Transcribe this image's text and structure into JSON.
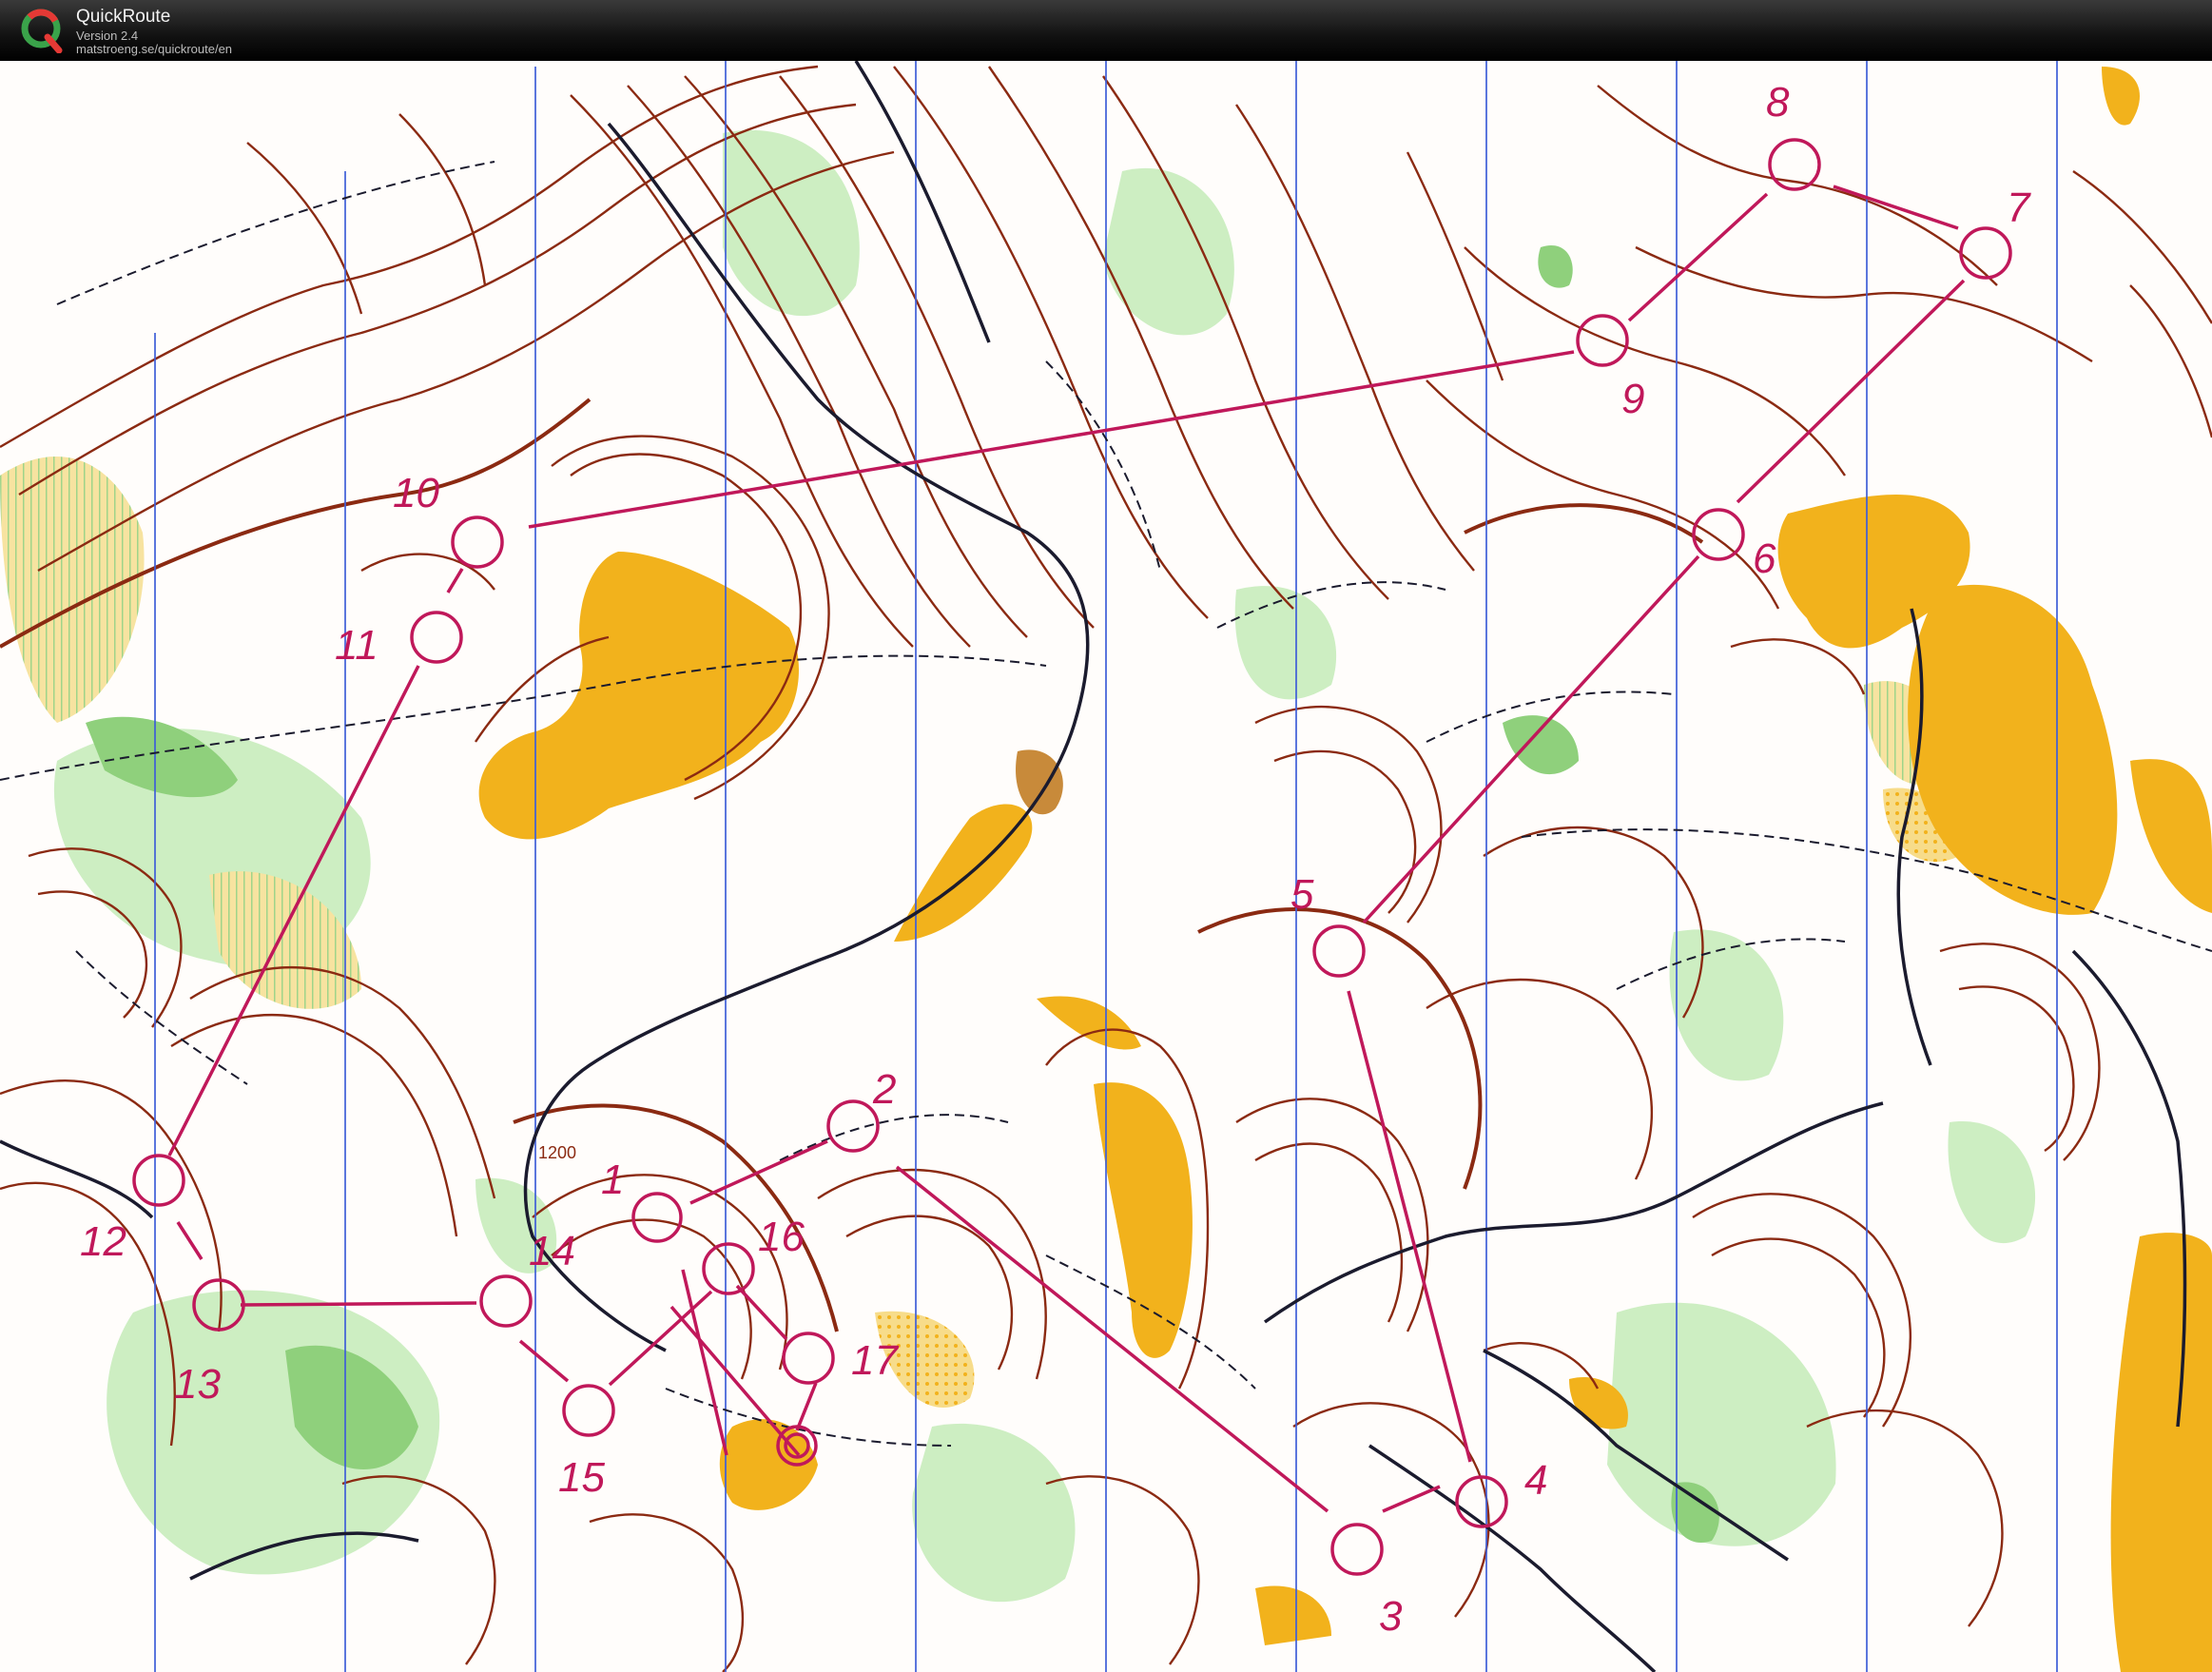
{
  "app": {
    "name": "QuickRoute",
    "version": "Version 2.4",
    "url": "matstroeng.se/quickroute/en"
  },
  "map": {
    "colors": {
      "paper": "#ffffff",
      "contour": "#8b2a12",
      "open_land": "#f2b21c",
      "rough_open": "#f7dc8a",
      "vegetation": "#8fd07c",
      "vegetation_light": "#cdeec2",
      "paths": "#1b1b2e",
      "north_lines": "#3f5fd8",
      "course": "#c0185a"
    },
    "controls": [
      {
        "label": "1"
      },
      {
        "label": "2"
      },
      {
        "label": "3"
      },
      {
        "label": "4"
      },
      {
        "label": "5"
      },
      {
        "label": "6"
      },
      {
        "label": "7"
      },
      {
        "label": "8"
      },
      {
        "label": "9"
      },
      {
        "label": "10"
      },
      {
        "label": "11"
      },
      {
        "label": "12"
      },
      {
        "label": "13"
      },
      {
        "label": "14"
      },
      {
        "label": "15"
      },
      {
        "label": "16"
      },
      {
        "label": "17"
      }
    ],
    "contour_label": "1200"
  }
}
